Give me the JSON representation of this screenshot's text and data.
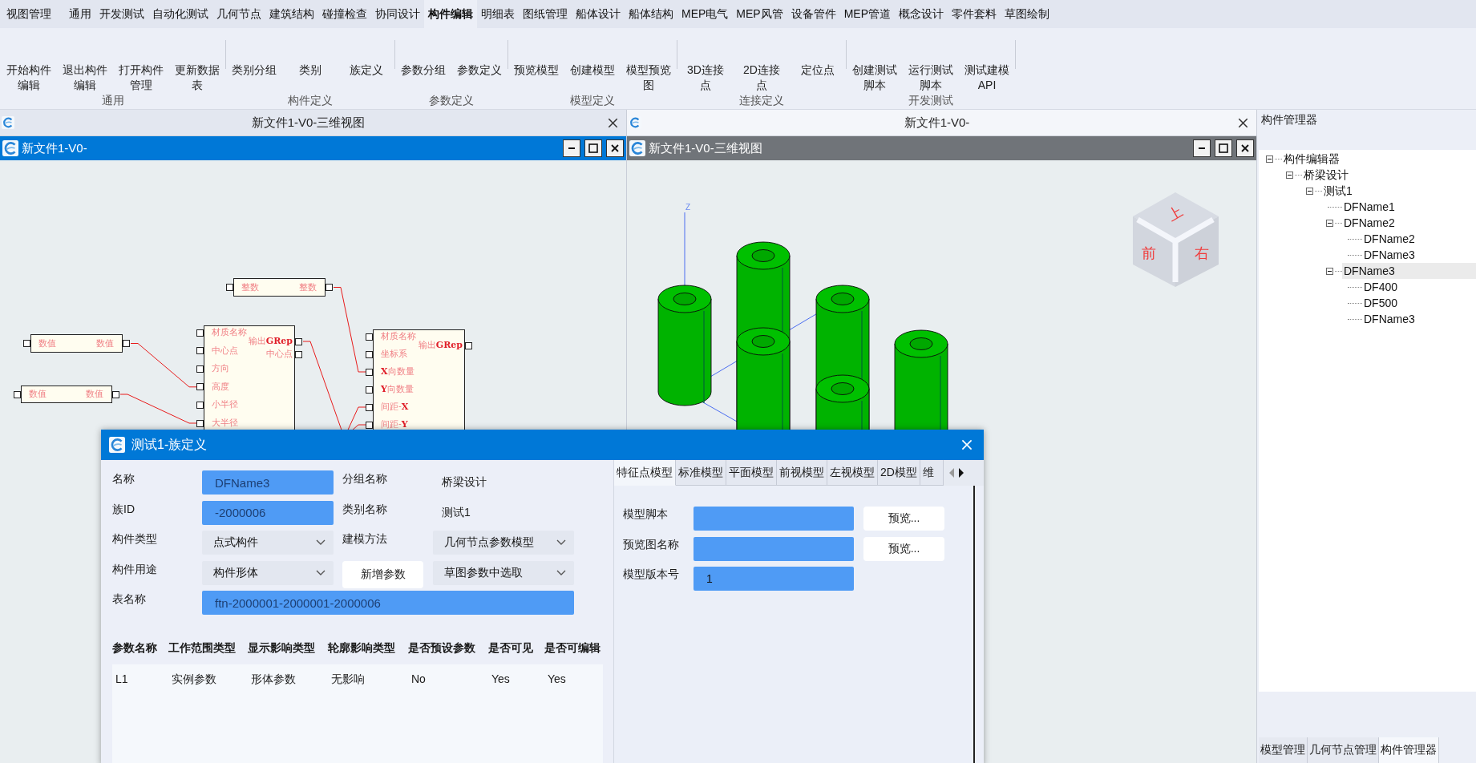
{
  "menu": [
    {
      "label": "视图管理",
      "selected": false
    },
    {
      "label": "通用",
      "selected": false
    },
    {
      "label": "开发测试",
      "selected": false
    },
    {
      "label": "自动化测试",
      "selected": false
    },
    {
      "label": "几何节点",
      "selected": false
    },
    {
      "label": "建筑结构",
      "selected": false
    },
    {
      "label": "碰撞检查",
      "selected": false
    },
    {
      "label": "协同设计",
      "selected": false
    },
    {
      "label": "构件编辑",
      "selected": true
    },
    {
      "label": "明细表",
      "selected": false
    },
    {
      "label": "图纸管理",
      "selected": false
    },
    {
      "label": "船体设计",
      "selected": false
    },
    {
      "label": "船体结构",
      "selected": false
    },
    {
      "label": "MEP电气",
      "selected": false
    },
    {
      "label": "MEP风管",
      "selected": false
    },
    {
      "label": "设备管件",
      "selected": false
    },
    {
      "label": "MEP管道",
      "selected": false
    },
    {
      "label": "概念设计",
      "selected": false
    },
    {
      "label": "零件套料",
      "selected": false
    },
    {
      "label": "草图绘制",
      "selected": false
    }
  ],
  "ribbon": [
    {
      "group": "通用",
      "buttons": [
        "开始构件编辑",
        "退出构件编辑",
        "打开构件管理",
        "更新数据表"
      ]
    },
    {
      "group": "构件定义",
      "buttons": [
        "类别分组",
        "类别",
        "族定义"
      ]
    },
    {
      "group": "参数定义",
      "buttons": [
        "参数分组",
        "参数定义"
      ]
    },
    {
      "group": "模型定义",
      "buttons": [
        "预览模型",
        "创建模型",
        "模型预览图"
      ]
    },
    {
      "group": "连接定义",
      "buttons": [
        "3D连接点",
        "2D连接点",
        "定位点"
      ]
    },
    {
      "group": "开发测试",
      "buttons": [
        "创建测试脚本",
        "运行测试脚本",
        "测试建模API"
      ]
    }
  ],
  "documents": [
    {
      "title": "新文件1-V0-三维视图",
      "selected": false,
      "window_title": "新文件1-V0-",
      "window_active": true,
      "kind": "graph"
    },
    {
      "title": "新文件1-V0-",
      "selected": true,
      "window_title": "新文件1-V0-三维视图",
      "window_active": false,
      "kind": "model"
    }
  ],
  "node_graph": {
    "nodes": [
      {
        "inputs": [
          "整数"
        ],
        "outputs": [
          "整数"
        ]
      },
      {
        "inputs": [
          "数值"
        ],
        "outputs": [
          "数值"
        ]
      },
      {
        "inputs": [
          "数值"
        ],
        "outputs": [
          "数值"
        ]
      },
      {
        "inputs": [
          "材质名称",
          "中心点",
          "方向",
          "高度",
          "小半径",
          "大半径"
        ],
        "outputs": [
          "输出**GRep**",
          "中心点"
        ]
      },
      {
        "inputs": [
          "材质名称",
          "坐标系",
          "**X**向数量",
          "**Y**向数量",
          "间距-**X**",
          "间距-**Y**"
        ],
        "outputs": [
          "输出**GRep**"
        ]
      }
    ]
  },
  "model_view": {
    "axis_label": "Z",
    "view_cube": [
      "上",
      "前",
      "右"
    ]
  },
  "dialog": {
    "title": "测试1-族定义",
    "form": [
      [
        {
          "label": "名称",
          "kind": "input",
          "value": "DFName3",
          "disabled": true
        },
        {
          "label": "分组名称",
          "kind": "text",
          "value": "桥梁设计"
        }
      ],
      [
        {
          "label": "族ID",
          "kind": "input",
          "value": "-2000006",
          "disabled": true
        },
        {
          "label": "类别名称",
          "kind": "text",
          "value": "测试1"
        }
      ],
      [
        {
          "label": "构件类型",
          "kind": "select",
          "value": "点式构件"
        },
        {
          "label": "建模方法",
          "kind": "select",
          "value": "几何节点参数模型"
        }
      ],
      [
        {
          "label": "构件用途",
          "kind": "select",
          "value": "构件形体"
        },
        {
          "kind": "button",
          "value": "新增参数"
        },
        {
          "kind": "select",
          "value": "草图参数中选取"
        }
      ],
      [
        {
          "label": "表名称",
          "kind": "input",
          "value": "ftn-2000001-2000001-2000006",
          "disabled": true
        }
      ]
    ],
    "table": {
      "columns": [
        "参数名称",
        "工作范围类型",
        "显示影响类型",
        "轮廓影响类型",
        "是否预设参数",
        "是否可见",
        "是否可编辑"
      ],
      "rows": [
        [
          "L1",
          "实例参数",
          "形体参数",
          "无影响",
          "No",
          "Yes",
          "Yes"
        ]
      ]
    },
    "tabs": [
      {
        "label": "特征点模型",
        "selected": true
      },
      {
        "label": "标准模型",
        "selected": false
      },
      {
        "label": "平面模型",
        "selected": false
      },
      {
        "label": "前视模型",
        "selected": false
      },
      {
        "label": "左视模型",
        "selected": false
      },
      {
        "label": "2D模型",
        "selected": false
      },
      {
        "label": "维",
        "selected": false
      }
    ],
    "model_fields": [
      {
        "label": "模型脚本",
        "button": "预览..."
      },
      {
        "label": "预览图名称",
        "button": "预览..."
      },
      {
        "label": "模型版本号",
        "value": "1"
      }
    ]
  },
  "component_manager": {
    "title": "构件管理器",
    "tree": [
      {
        "label": "构件编辑器",
        "expanded": true,
        "selected": false,
        "children": [
          {
            "label": "桥梁设计",
            "expanded": true,
            "selected": false,
            "children": [
              {
                "label": "测试1",
                "expanded": true,
                "selected": false,
                "children": [
                  {
                    "label": "DFName1",
                    "selected": false
                  },
                  {
                    "label": "DFName2",
                    "expanded": true,
                    "selected": false,
                    "children": [
                      {
                        "label": "DFName2",
                        "selected": false
                      },
                      {
                        "label": "DFName3",
                        "selected": false
                      }
                    ]
                  },
                  {
                    "label": "DFName3",
                    "expanded": true,
                    "selected": true,
                    "children": [
                      {
                        "label": "DF400",
                        "selected": false
                      },
                      {
                        "label": "DF500",
                        "selected": false
                      },
                      {
                        "label": "DFName3",
                        "selected": false
                      }
                    ]
                  }
                ]
              }
            ]
          }
        ]
      }
    ],
    "tabs": [
      {
        "label": "模型管理",
        "selected": false
      },
      {
        "label": "几何节点管理",
        "selected": false
      },
      {
        "label": "构件管理器",
        "selected": true
      }
    ]
  }
}
